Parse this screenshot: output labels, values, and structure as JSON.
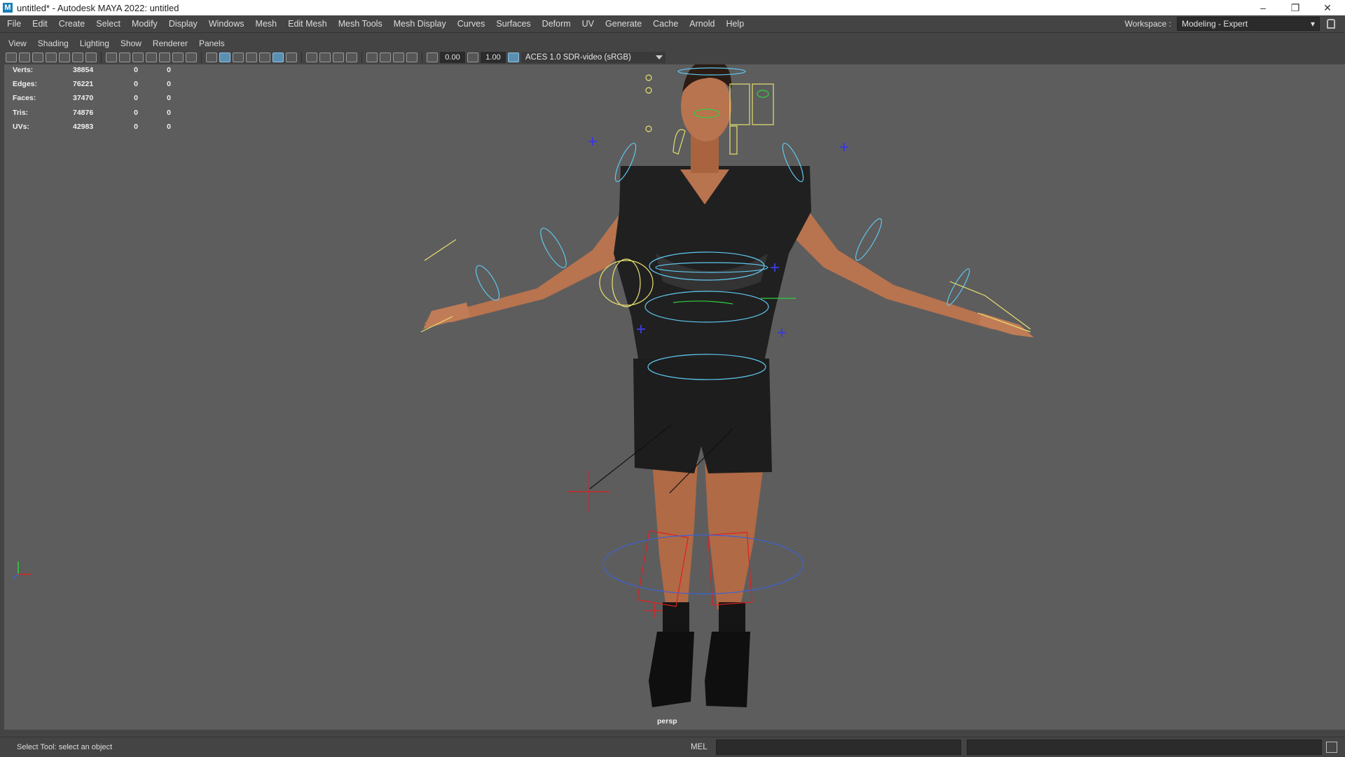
{
  "window": {
    "title": "untitled* - Autodesk MAYA 2022: untitled",
    "logo_letter": "M",
    "controls": [
      "–",
      "❐",
      "✕"
    ]
  },
  "menu": [
    "File",
    "Edit",
    "Create",
    "Select",
    "Modify",
    "Display",
    "Windows",
    "Mesh",
    "Edit Mesh",
    "Mesh Tools",
    "Mesh Display",
    "Curves",
    "Surfaces",
    "Deform",
    "UV",
    "Generate",
    "Cache",
    "Arnold",
    "Help"
  ],
  "workspace": {
    "label": "Workspace :",
    "value": "Modeling - Expert"
  },
  "panel_menu": [
    "View",
    "Shading",
    "Lighting",
    "Show",
    "Renderer",
    "Panels"
  ],
  "panel_toolbar": {
    "exposure": "0.00",
    "gamma": "1.00",
    "color_space": "ACES 1.0 SDR-video (sRGB)"
  },
  "heads_up": {
    "rows": [
      {
        "label": "Verts:",
        "v1": "38854",
        "v2": "0",
        "v3": "0"
      },
      {
        "label": "Edges:",
        "v1": "76221",
        "v2": "0",
        "v3": "0"
      },
      {
        "label": "Faces:",
        "v1": "37470",
        "v2": "0",
        "v3": "0"
      },
      {
        "label": "Tris:",
        "v1": "74876",
        "v2": "0",
        "v3": "0"
      },
      {
        "label": "UVs:",
        "v1": "42983",
        "v2": "0",
        "v3": "0"
      }
    ]
  },
  "camera": "persp",
  "status": {
    "message": "Select Tool: select an object",
    "script_type": "MEL"
  },
  "colors": {
    "viewport_bg": "#5d5d5d",
    "skin": "#b8734f",
    "cloth": "#1c1c1c",
    "rig_cyan": "#5fc8f0",
    "rig_yellow": "#e8e070",
    "rig_blue": "#3a3ad8",
    "rig_red": "#e02020",
    "rig_green": "#30d040"
  }
}
